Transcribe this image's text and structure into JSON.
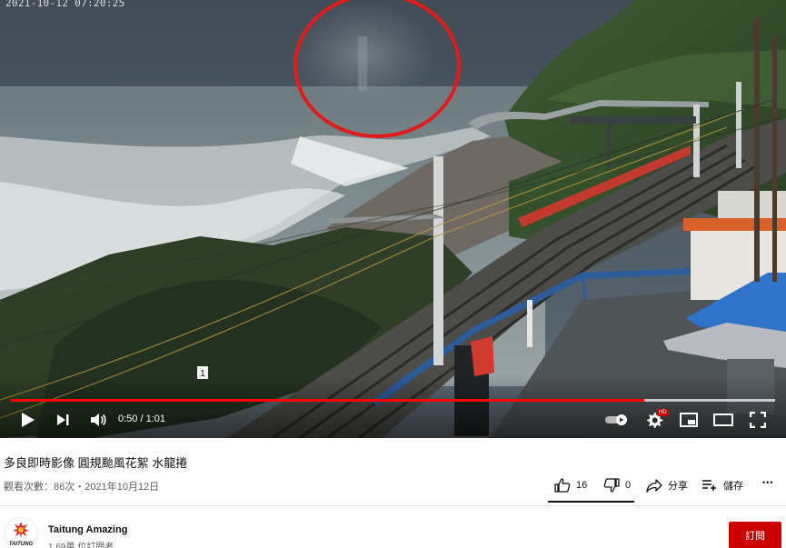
{
  "player": {
    "camera_timestamp": "2021-10-12 07:20:25",
    "sign_number": "1",
    "time_current": "0:50",
    "time_duration": "1:01",
    "time_separator": " / ",
    "progress_played_fraction": 0.829,
    "progress_buffered_fraction": 1.0,
    "accent_color": "#ff0000",
    "controls": {
      "play": "play-icon",
      "next": "next-icon",
      "volume": "volume-icon",
      "autoplay": "autoplay-toggle-icon",
      "settings": "gear-icon",
      "settings_badge": "HD",
      "miniplayer": "miniplayer-icon",
      "theater": "theater-mode-icon",
      "fullscreen": "fullscreen-icon"
    }
  },
  "video": {
    "title": "多良即時影像 圓規颱風花絮 水龍捲",
    "meta": "觀看次數：86次・2021年10月12日"
  },
  "actions": {
    "like_count": "16",
    "dislike_count": "0",
    "share_label": "分享",
    "save_label": "儲存",
    "more_label": "•••",
    "like_fraction": 1.0
  },
  "channel": {
    "name": "Taitung Amazing",
    "subscribers": "1.69萬 位訂閱者",
    "avatar_text": "TAITUNG",
    "subscribe_label": "訂閱",
    "subscribe_color": "#cc0000"
  }
}
